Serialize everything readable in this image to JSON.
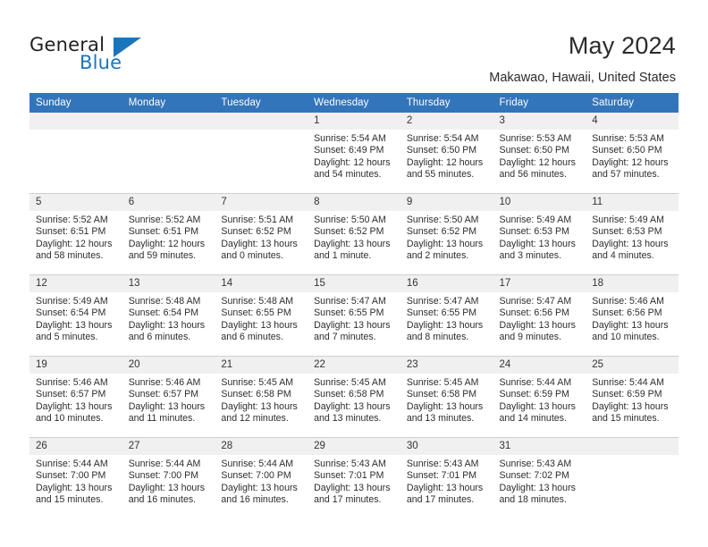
{
  "brand": {
    "word_one": "General",
    "word_two": "Blue",
    "accent_color": "#1b75bb"
  },
  "header": {
    "title": "May 2024",
    "location": "Makawao, Hawaii, United States"
  },
  "calendar": {
    "header_bg": "#3275bb",
    "daynum_bg": "#f0f0f0",
    "weekday_headers": [
      "Sunday",
      "Monday",
      "Tuesday",
      "Wednesday",
      "Thursday",
      "Friday",
      "Saturday"
    ],
    "labels": {
      "sunrise": "Sunrise:",
      "sunset": "Sunset:",
      "daylight": "Daylight:"
    },
    "weeks": [
      [
        {
          "day": "",
          "empty": true
        },
        {
          "day": "",
          "empty": true
        },
        {
          "day": "",
          "empty": true
        },
        {
          "day": "1",
          "sunrise": "Sunrise: 5:54 AM",
          "sunset": "Sunset: 6:49 PM",
          "daylight": "Daylight: 12 hours and 54 minutes."
        },
        {
          "day": "2",
          "sunrise": "Sunrise: 5:54 AM",
          "sunset": "Sunset: 6:50 PM",
          "daylight": "Daylight: 12 hours and 55 minutes."
        },
        {
          "day": "3",
          "sunrise": "Sunrise: 5:53 AM",
          "sunset": "Sunset: 6:50 PM",
          "daylight": "Daylight: 12 hours and 56 minutes."
        },
        {
          "day": "4",
          "sunrise": "Sunrise: 5:53 AM",
          "sunset": "Sunset: 6:50 PM",
          "daylight": "Daylight: 12 hours and 57 minutes."
        }
      ],
      [
        {
          "day": "5",
          "sunrise": "Sunrise: 5:52 AM",
          "sunset": "Sunset: 6:51 PM",
          "daylight": "Daylight: 12 hours and 58 minutes."
        },
        {
          "day": "6",
          "sunrise": "Sunrise: 5:52 AM",
          "sunset": "Sunset: 6:51 PM",
          "daylight": "Daylight: 12 hours and 59 minutes."
        },
        {
          "day": "7",
          "sunrise": "Sunrise: 5:51 AM",
          "sunset": "Sunset: 6:52 PM",
          "daylight": "Daylight: 13 hours and 0 minutes."
        },
        {
          "day": "8",
          "sunrise": "Sunrise: 5:50 AM",
          "sunset": "Sunset: 6:52 PM",
          "daylight": "Daylight: 13 hours and 1 minute."
        },
        {
          "day": "9",
          "sunrise": "Sunrise: 5:50 AM",
          "sunset": "Sunset: 6:52 PM",
          "daylight": "Daylight: 13 hours and 2 minutes."
        },
        {
          "day": "10",
          "sunrise": "Sunrise: 5:49 AM",
          "sunset": "Sunset: 6:53 PM",
          "daylight": "Daylight: 13 hours and 3 minutes."
        },
        {
          "day": "11",
          "sunrise": "Sunrise: 5:49 AM",
          "sunset": "Sunset: 6:53 PM",
          "daylight": "Daylight: 13 hours and 4 minutes."
        }
      ],
      [
        {
          "day": "12",
          "sunrise": "Sunrise: 5:49 AM",
          "sunset": "Sunset: 6:54 PM",
          "daylight": "Daylight: 13 hours and 5 minutes."
        },
        {
          "day": "13",
          "sunrise": "Sunrise: 5:48 AM",
          "sunset": "Sunset: 6:54 PM",
          "daylight": "Daylight: 13 hours and 6 minutes."
        },
        {
          "day": "14",
          "sunrise": "Sunrise: 5:48 AM",
          "sunset": "Sunset: 6:55 PM",
          "daylight": "Daylight: 13 hours and 6 minutes."
        },
        {
          "day": "15",
          "sunrise": "Sunrise: 5:47 AM",
          "sunset": "Sunset: 6:55 PM",
          "daylight": "Daylight: 13 hours and 7 minutes."
        },
        {
          "day": "16",
          "sunrise": "Sunrise: 5:47 AM",
          "sunset": "Sunset: 6:55 PM",
          "daylight": "Daylight: 13 hours and 8 minutes."
        },
        {
          "day": "17",
          "sunrise": "Sunrise: 5:47 AM",
          "sunset": "Sunset: 6:56 PM",
          "daylight": "Daylight: 13 hours and 9 minutes."
        },
        {
          "day": "18",
          "sunrise": "Sunrise: 5:46 AM",
          "sunset": "Sunset: 6:56 PM",
          "daylight": "Daylight: 13 hours and 10 minutes."
        }
      ],
      [
        {
          "day": "19",
          "sunrise": "Sunrise: 5:46 AM",
          "sunset": "Sunset: 6:57 PM",
          "daylight": "Daylight: 13 hours and 10 minutes."
        },
        {
          "day": "20",
          "sunrise": "Sunrise: 5:46 AM",
          "sunset": "Sunset: 6:57 PM",
          "daylight": "Daylight: 13 hours and 11 minutes."
        },
        {
          "day": "21",
          "sunrise": "Sunrise: 5:45 AM",
          "sunset": "Sunset: 6:58 PM",
          "daylight": "Daylight: 13 hours and 12 minutes."
        },
        {
          "day": "22",
          "sunrise": "Sunrise: 5:45 AM",
          "sunset": "Sunset: 6:58 PM",
          "daylight": "Daylight: 13 hours and 13 minutes."
        },
        {
          "day": "23",
          "sunrise": "Sunrise: 5:45 AM",
          "sunset": "Sunset: 6:58 PM",
          "daylight": "Daylight: 13 hours and 13 minutes."
        },
        {
          "day": "24",
          "sunrise": "Sunrise: 5:44 AM",
          "sunset": "Sunset: 6:59 PM",
          "daylight": "Daylight: 13 hours and 14 minutes."
        },
        {
          "day": "25",
          "sunrise": "Sunrise: 5:44 AM",
          "sunset": "Sunset: 6:59 PM",
          "daylight": "Daylight: 13 hours and 15 minutes."
        }
      ],
      [
        {
          "day": "26",
          "sunrise": "Sunrise: 5:44 AM",
          "sunset": "Sunset: 7:00 PM",
          "daylight": "Daylight: 13 hours and 15 minutes."
        },
        {
          "day": "27",
          "sunrise": "Sunrise: 5:44 AM",
          "sunset": "Sunset: 7:00 PM",
          "daylight": "Daylight: 13 hours and 16 minutes."
        },
        {
          "day": "28",
          "sunrise": "Sunrise: 5:44 AM",
          "sunset": "Sunset: 7:00 PM",
          "daylight": "Daylight: 13 hours and 16 minutes."
        },
        {
          "day": "29",
          "sunrise": "Sunrise: 5:43 AM",
          "sunset": "Sunset: 7:01 PM",
          "daylight": "Daylight: 13 hours and 17 minutes."
        },
        {
          "day": "30",
          "sunrise": "Sunrise: 5:43 AM",
          "sunset": "Sunset: 7:01 PM",
          "daylight": "Daylight: 13 hours and 17 minutes."
        },
        {
          "day": "31",
          "sunrise": "Sunrise: 5:43 AM",
          "sunset": "Sunset: 7:02 PM",
          "daylight": "Daylight: 13 hours and 18 minutes."
        },
        {
          "day": "",
          "empty": true
        }
      ]
    ]
  }
}
